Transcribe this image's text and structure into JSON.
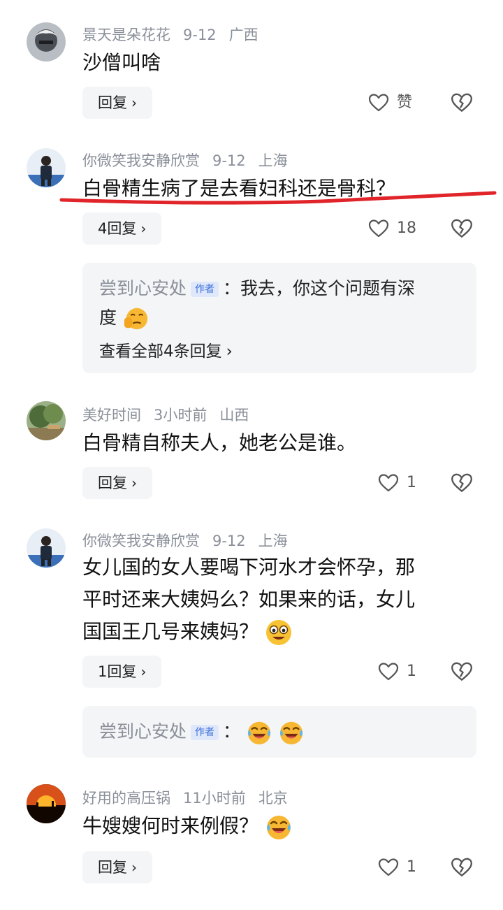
{
  "comments": [
    {
      "user": "景天是朵花花",
      "date": "9-12",
      "location": "广西",
      "text": "沙僧叫啥",
      "reply_label": "回复",
      "like_label": "赞"
    },
    {
      "user": "你微笑我安静欣赏",
      "date": "9-12",
      "location": "上海",
      "text": "白骨精生病了是去看妇科还是骨科？",
      "reply_label": "4回复",
      "like_label": "18",
      "thread": {
        "author": "尝到心安处",
        "tag": "作者",
        "line1": "：我去，你这个问题有深",
        "line2": "度",
        "more": "查看全部4条回复"
      }
    },
    {
      "user": "美好时间",
      "date": "3小时前",
      "location": "山西",
      "text": "白骨精自称夫人，她老公是谁。",
      "reply_label": "回复",
      "like_label": "1"
    },
    {
      "user": "你微笑我安静欣赏",
      "date": "9-12",
      "location": "上海",
      "line1": "女儿国的女人要喝下河水才会怀孕，那",
      "line2": "平时还来大姨妈么？如果来的话，女儿",
      "line3": "国国王几号来姨妈？",
      "reply_label": "1回复",
      "like_label": "1",
      "thread": {
        "author": "尝到心安处",
        "tag": "作者",
        "text": "："
      }
    },
    {
      "user": "好用的高压锅",
      "date": "11小时前",
      "location": "北京",
      "text": "牛嫂嫂何时来例假？",
      "reply_label": "回复",
      "like_label": "1"
    }
  ],
  "icons": {
    "chevron": "›",
    "heart": "heart-outline-icon",
    "dislike": "broken-heart-icon"
  },
  "colors": {
    "meta": "#8a8f99",
    "highlight_stroke": "#e0242a",
    "author_tag": "#3d6fd8"
  }
}
